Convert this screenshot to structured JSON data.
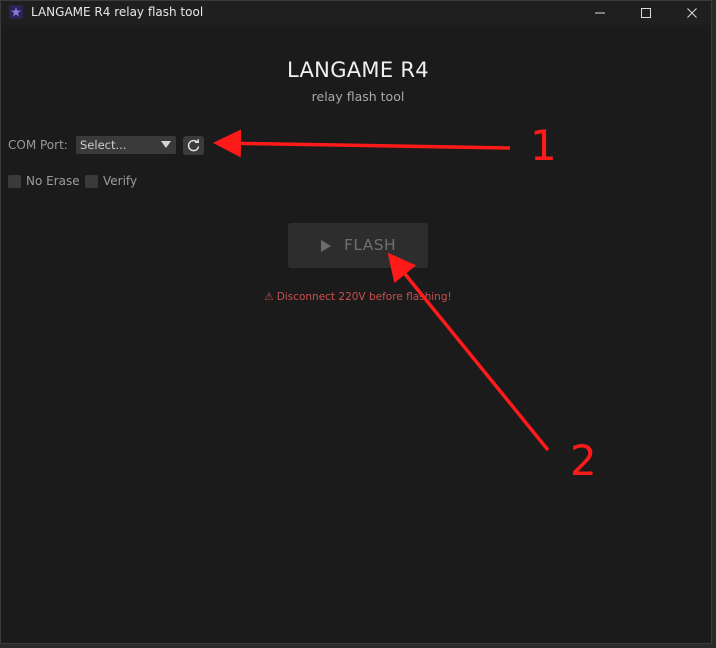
{
  "window": {
    "title": "LANGAME R4 relay flash tool"
  },
  "app": {
    "title": "LANGAME R4",
    "subtitle": "relay flash tool"
  },
  "com_port": {
    "label": "COM Port:",
    "selected": "Select...",
    "refresh_icon": "refresh-icon"
  },
  "options": {
    "no_erase": {
      "label": "No Erase",
      "checked": false
    },
    "verify": {
      "label": "Verify",
      "checked": false
    }
  },
  "flash": {
    "label": "FLASH",
    "enabled": false
  },
  "warning": {
    "icon": "⚠",
    "text": "Disconnect 220V before flashing!"
  },
  "annotations": {
    "marker_1": "1",
    "marker_2": "2",
    "color": "#ff1a1a"
  },
  "colors": {
    "background": "#1b1b1b",
    "warning": "#c94f4f",
    "annotation": "#ff1a1a"
  }
}
